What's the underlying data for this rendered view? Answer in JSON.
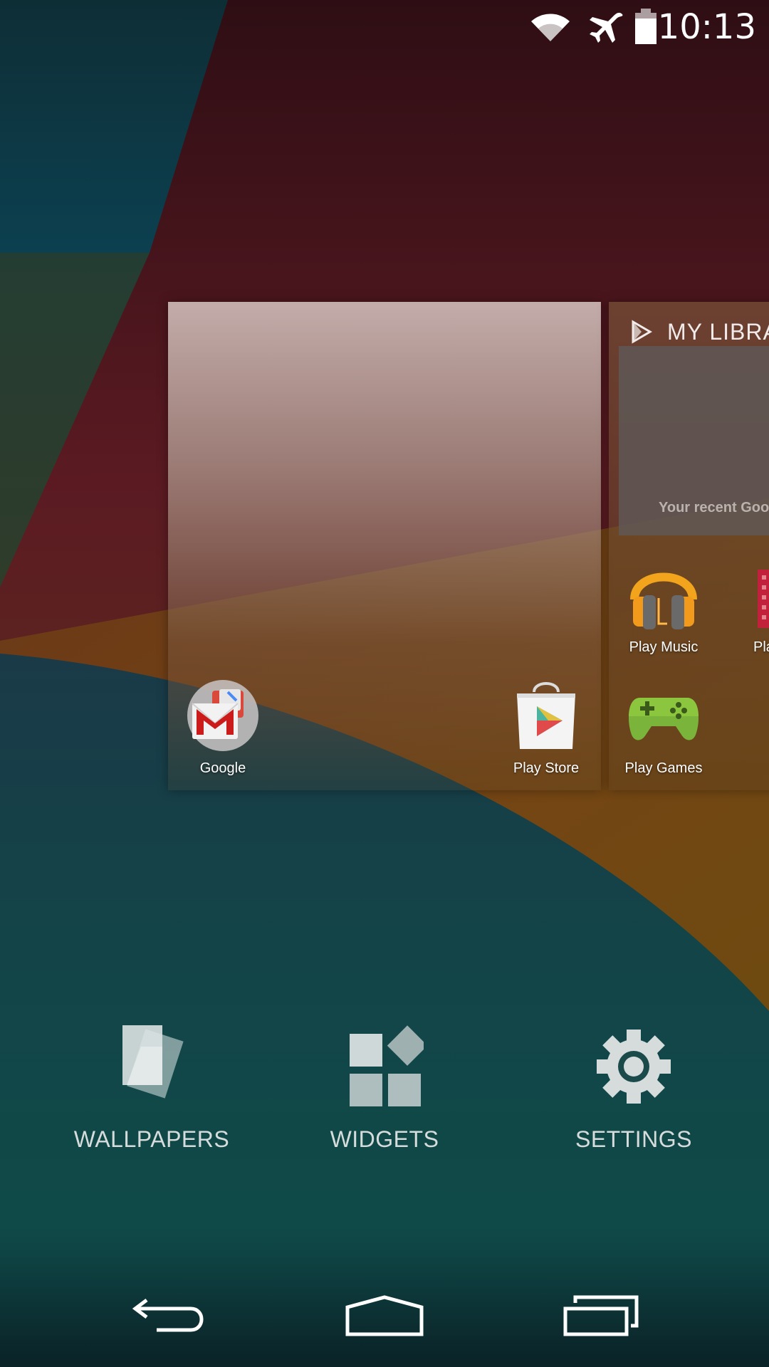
{
  "status_bar": {
    "time": "10:13",
    "icons": [
      "wifi-icon",
      "airplane-mode-icon",
      "battery-icon"
    ]
  },
  "pages": {
    "right_card": {
      "header_title": "MY LIBRA",
      "panel_text": "Your recent Goo"
    }
  },
  "apps": [
    {
      "label": "Google",
      "icon": "google-folder-icon"
    },
    {
      "label": "Play Store",
      "icon": "play-store-icon"
    },
    {
      "label": "Play Music",
      "icon": "play-music-icon"
    },
    {
      "label": "Play Mo",
      "icon": "play-movies-icon"
    },
    {
      "label": "Play Games",
      "icon": "play-games-icon"
    }
  ],
  "options": {
    "wallpapers": "WALLPAPERS",
    "widgets": "WIDGETS",
    "settings": "SETTINGS"
  },
  "nav": {
    "icons": [
      "back-icon",
      "home-icon",
      "recents-icon"
    ]
  },
  "colors": {
    "wallpaper_red": "#5a1a22",
    "wallpaper_teal": "#114a4c",
    "wallpaper_orange": "#7a4a14",
    "text_light": "#d6dcdc"
  }
}
